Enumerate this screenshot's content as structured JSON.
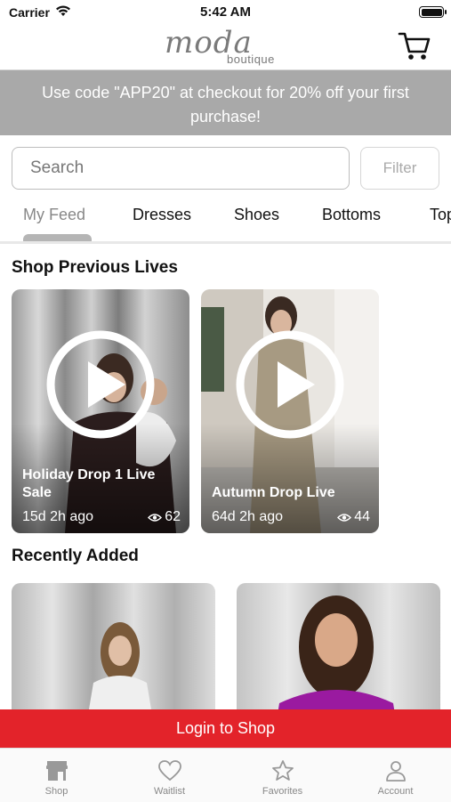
{
  "status_bar": {
    "carrier": "Carrier",
    "time": "5:42 AM"
  },
  "header": {
    "logo_main": "moda",
    "logo_sub": "boutique"
  },
  "promo": {
    "text": "Use code \"APP20\" at checkout for 20% off your first purchase!"
  },
  "search": {
    "placeholder": "Search",
    "filter_label": "Filter"
  },
  "categories": [
    "My Feed",
    "Dresses",
    "Shoes",
    "Bottoms",
    "Tops"
  ],
  "sections": {
    "previous_lives": "Shop Previous Lives",
    "recently_added": "Recently Added"
  },
  "lives": [
    {
      "title": "Holiday Drop 1 Live Sale",
      "time": "15d 2h ago",
      "views": "62"
    },
    {
      "title": "Autumn Drop Live",
      "time": "64d 2h ago",
      "views": "44"
    }
  ],
  "login_banner": "Login to Shop",
  "tabbar": [
    {
      "label": "Shop",
      "icon": "storefront-icon"
    },
    {
      "label": "Waitlist",
      "icon": "heart-icon"
    },
    {
      "label": "Favorites",
      "icon": "star-icon"
    },
    {
      "label": "Account",
      "icon": "person-icon"
    }
  ],
  "colors": {
    "promo_bg": "#a9a9a9",
    "login_red": "#e3232a",
    "tab_inactive": "#888888"
  }
}
